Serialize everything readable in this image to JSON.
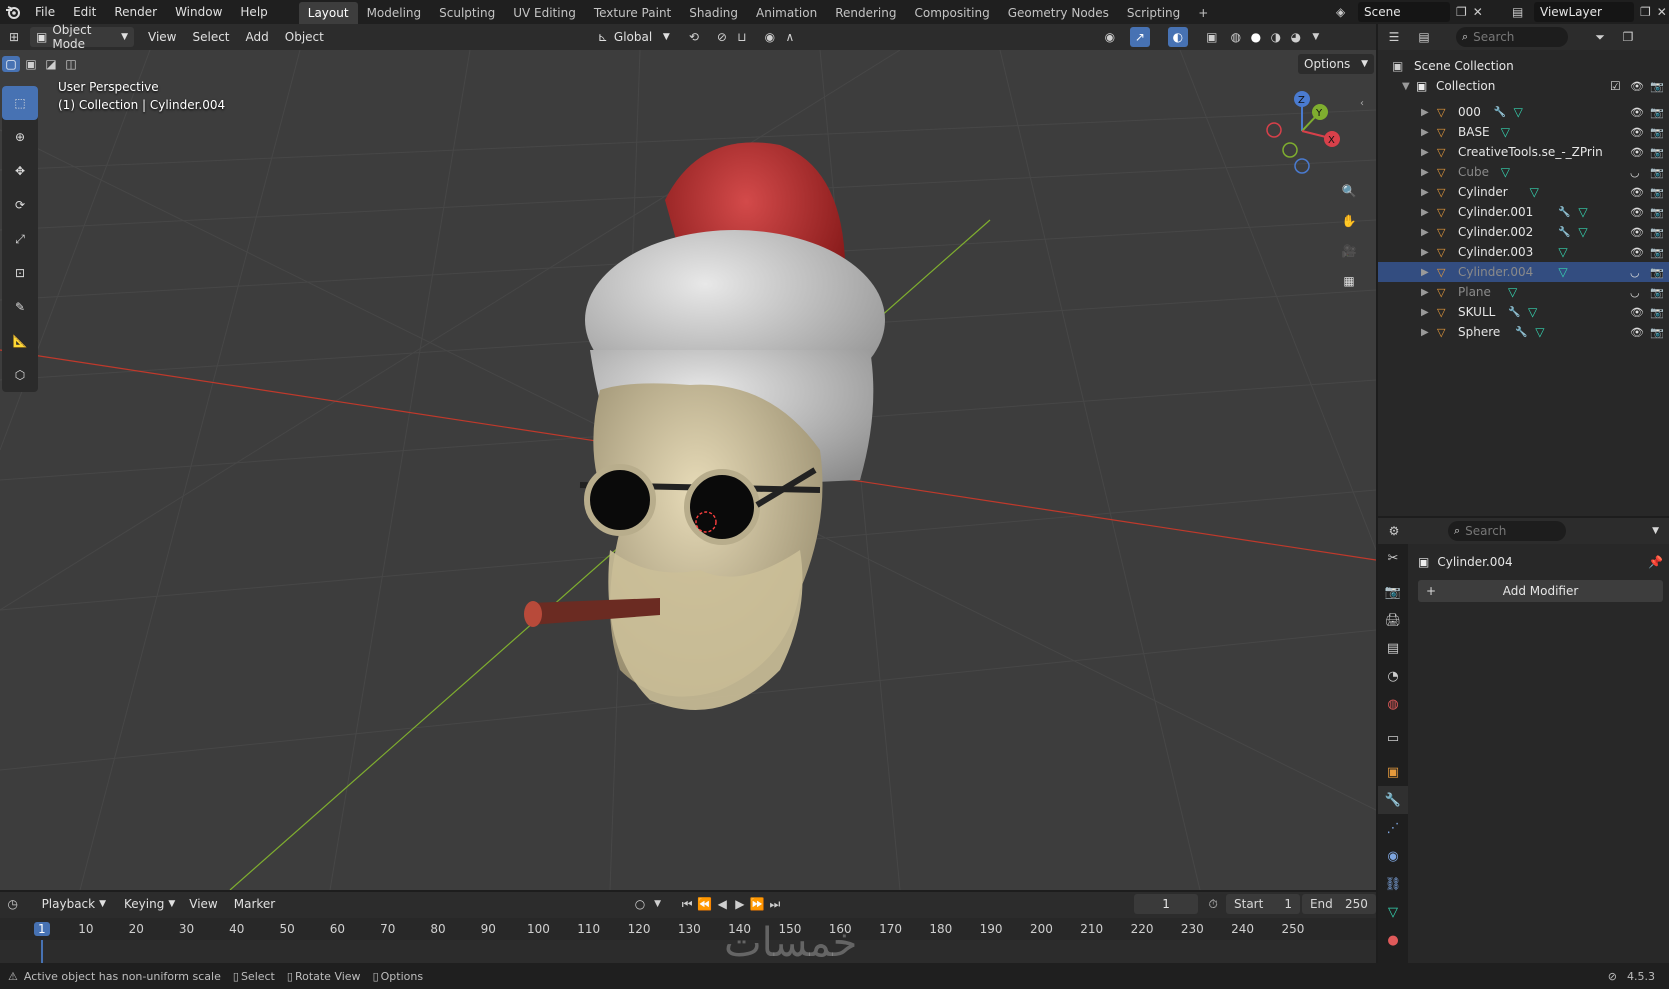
{
  "topbar": {
    "menus": [
      "File",
      "Edit",
      "Render",
      "Window",
      "Help"
    ],
    "workspaces": [
      "Layout",
      "Modeling",
      "Sculpting",
      "UV Editing",
      "Texture Paint",
      "Shading",
      "Animation",
      "Rendering",
      "Compositing",
      "Geometry Nodes",
      "Scripting"
    ],
    "active_workspace": "Layout",
    "add_tab": "+",
    "scene": "Scene",
    "view_layer": "ViewLayer"
  },
  "viewport_header": {
    "mode": "Object Mode",
    "menus": [
      "View",
      "Select",
      "Add",
      "Object"
    ],
    "orientation": "Global",
    "options": "Options"
  },
  "viewport": {
    "perspective": "User Perspective",
    "collection_info": "(1) Collection | Cylinder.004",
    "gizmo_axes": [
      "Z",
      "Y",
      "X"
    ]
  },
  "outliner": {
    "search_placeholder": "Search",
    "scene_collection": "Scene Collection",
    "collection": "Collection",
    "items": [
      {
        "label": "000",
        "modifier": true,
        "mesh": true,
        "hidden": false,
        "selected": false
      },
      {
        "label": "BASE",
        "modifier": false,
        "mesh": true,
        "hidden": false,
        "selected": false
      },
      {
        "label": "CreativeTools.se_-_ZPrin",
        "modifier": false,
        "mesh": false,
        "hidden": false,
        "selected": false
      },
      {
        "label": "Cube",
        "modifier": false,
        "mesh": true,
        "hidden": true,
        "selected": false
      },
      {
        "label": "Cylinder",
        "modifier": false,
        "mesh": true,
        "hidden": false,
        "selected": false
      },
      {
        "label": "Cylinder.001",
        "modifier": true,
        "mesh": true,
        "hidden": false,
        "selected": false
      },
      {
        "label": "Cylinder.002",
        "modifier": true,
        "mesh": true,
        "hidden": false,
        "selected": false
      },
      {
        "label": "Cylinder.003",
        "modifier": false,
        "mesh": true,
        "hidden": false,
        "selected": false
      },
      {
        "label": "Cylinder.004",
        "modifier": false,
        "mesh": true,
        "hidden": true,
        "selected": true
      },
      {
        "label": "Plane",
        "modifier": false,
        "mesh": true,
        "hidden": true,
        "selected": false
      },
      {
        "label": "SKULL",
        "modifier": true,
        "mesh": true,
        "hidden": false,
        "selected": false
      },
      {
        "label": "Sphere",
        "modifier": true,
        "mesh": true,
        "hidden": false,
        "selected": false
      }
    ]
  },
  "properties": {
    "search_placeholder": "Search",
    "object_name": "Cylinder.004",
    "add_modifier": "Add Modifier"
  },
  "timeline": {
    "menus": [
      "Playback",
      "Keying",
      "View",
      "Marker"
    ],
    "current_frame": "1",
    "start_label": "Start",
    "start": "1",
    "end_label": "End",
    "end": "250",
    "ticks": [
      "1",
      "10",
      "20",
      "30",
      "40",
      "50",
      "60",
      "70",
      "80",
      "90",
      "100",
      "110",
      "120",
      "130",
      "140",
      "150",
      "160",
      "170",
      "180",
      "190",
      "200",
      "210",
      "220",
      "230",
      "240",
      "250"
    ]
  },
  "statusbar": {
    "warning": "Active object has non-uniform scale",
    "select": "Select",
    "rotate": "Rotate View",
    "options": "Options",
    "version": "4.5.3"
  },
  "watermark": "خمسات",
  "colors": {
    "accent": "#4772b3",
    "selected_row": "#334d80",
    "x_axis": "#c0392b",
    "y_axis": "#7fae2f",
    "object_icon": "#e69a3c",
    "mesh_icon": "#36d4b1"
  }
}
